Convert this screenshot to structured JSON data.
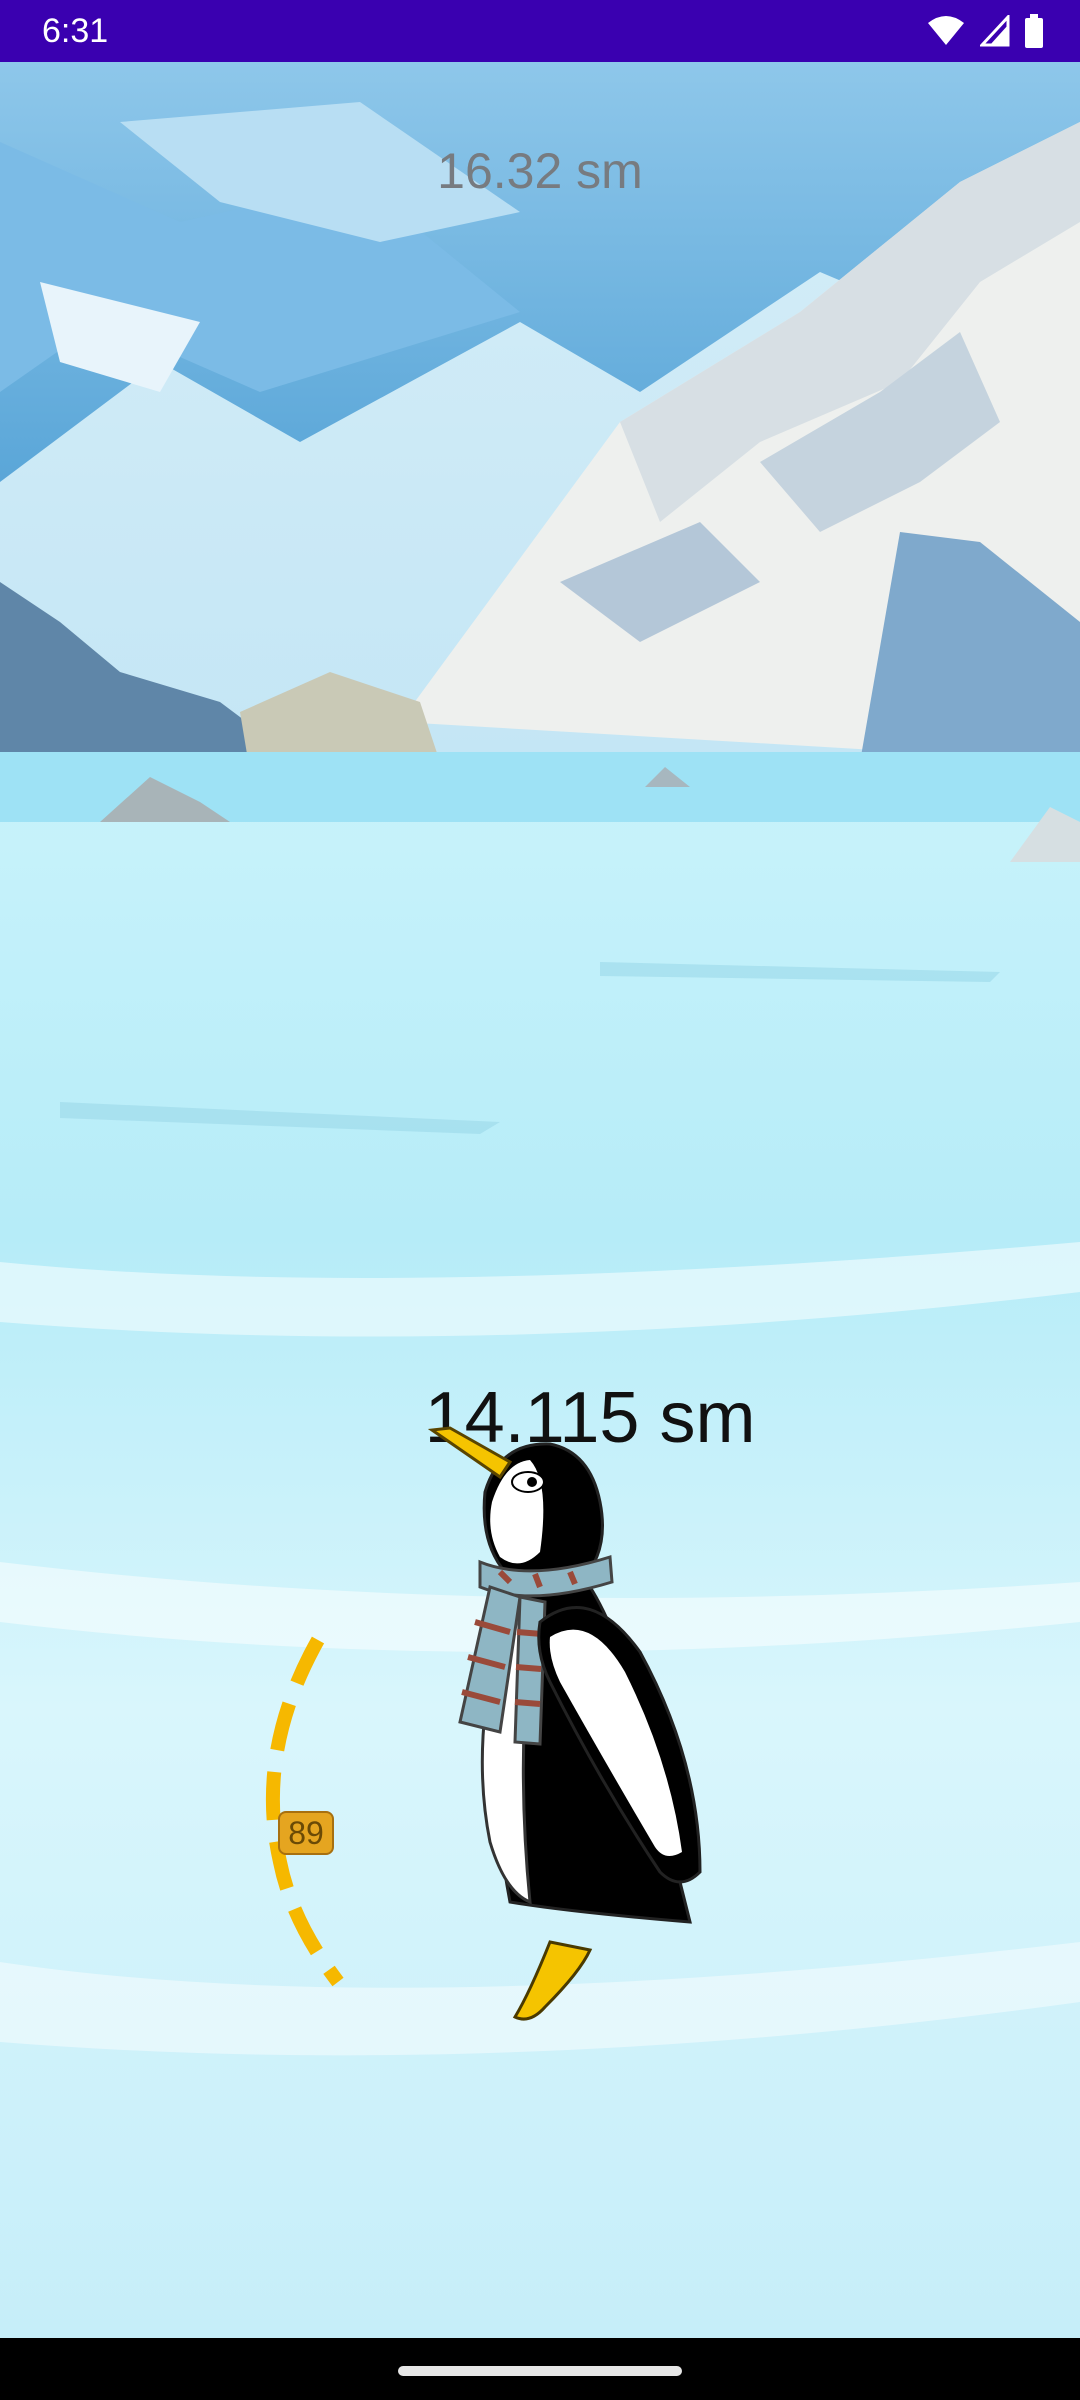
{
  "status_bar": {
    "time": "6:31",
    "icons": [
      "wifi-icon",
      "signal-icon",
      "battery-icon"
    ]
  },
  "game": {
    "best_distance": "16.32 sm",
    "current_distance": "14.115 sm",
    "launch_angle": "89"
  },
  "colors": {
    "status_bar": "#3a00b0",
    "aim_arc": "#f6b800",
    "penguin_beak": "#f5c800"
  }
}
